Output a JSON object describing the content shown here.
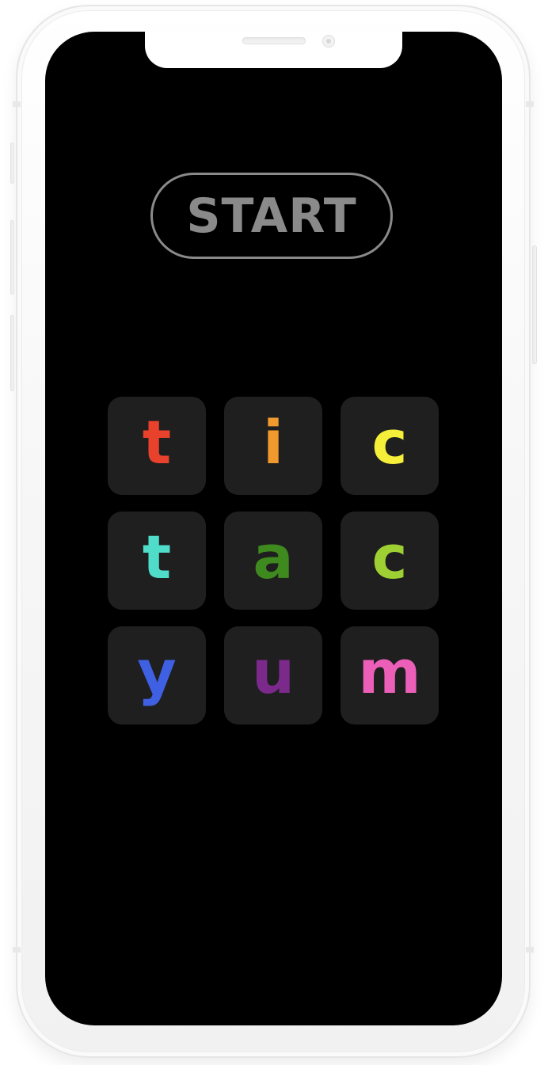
{
  "start_button": {
    "label": "START"
  },
  "grid": {
    "cells": [
      {
        "letter": "t",
        "color": "#e8412c"
      },
      {
        "letter": "i",
        "color": "#f0992d"
      },
      {
        "letter": "c",
        "color": "#f5ef3a"
      },
      {
        "letter": "t",
        "color": "#4fdcc9"
      },
      {
        "letter": "a",
        "color": "#3e8a1e"
      },
      {
        "letter": "c",
        "color": "#9fd033"
      },
      {
        "letter": "y",
        "color": "#3f60e3"
      },
      {
        "letter": "u",
        "color": "#7b2a8c"
      },
      {
        "letter": "m",
        "color": "#ec5fb8"
      }
    ]
  }
}
